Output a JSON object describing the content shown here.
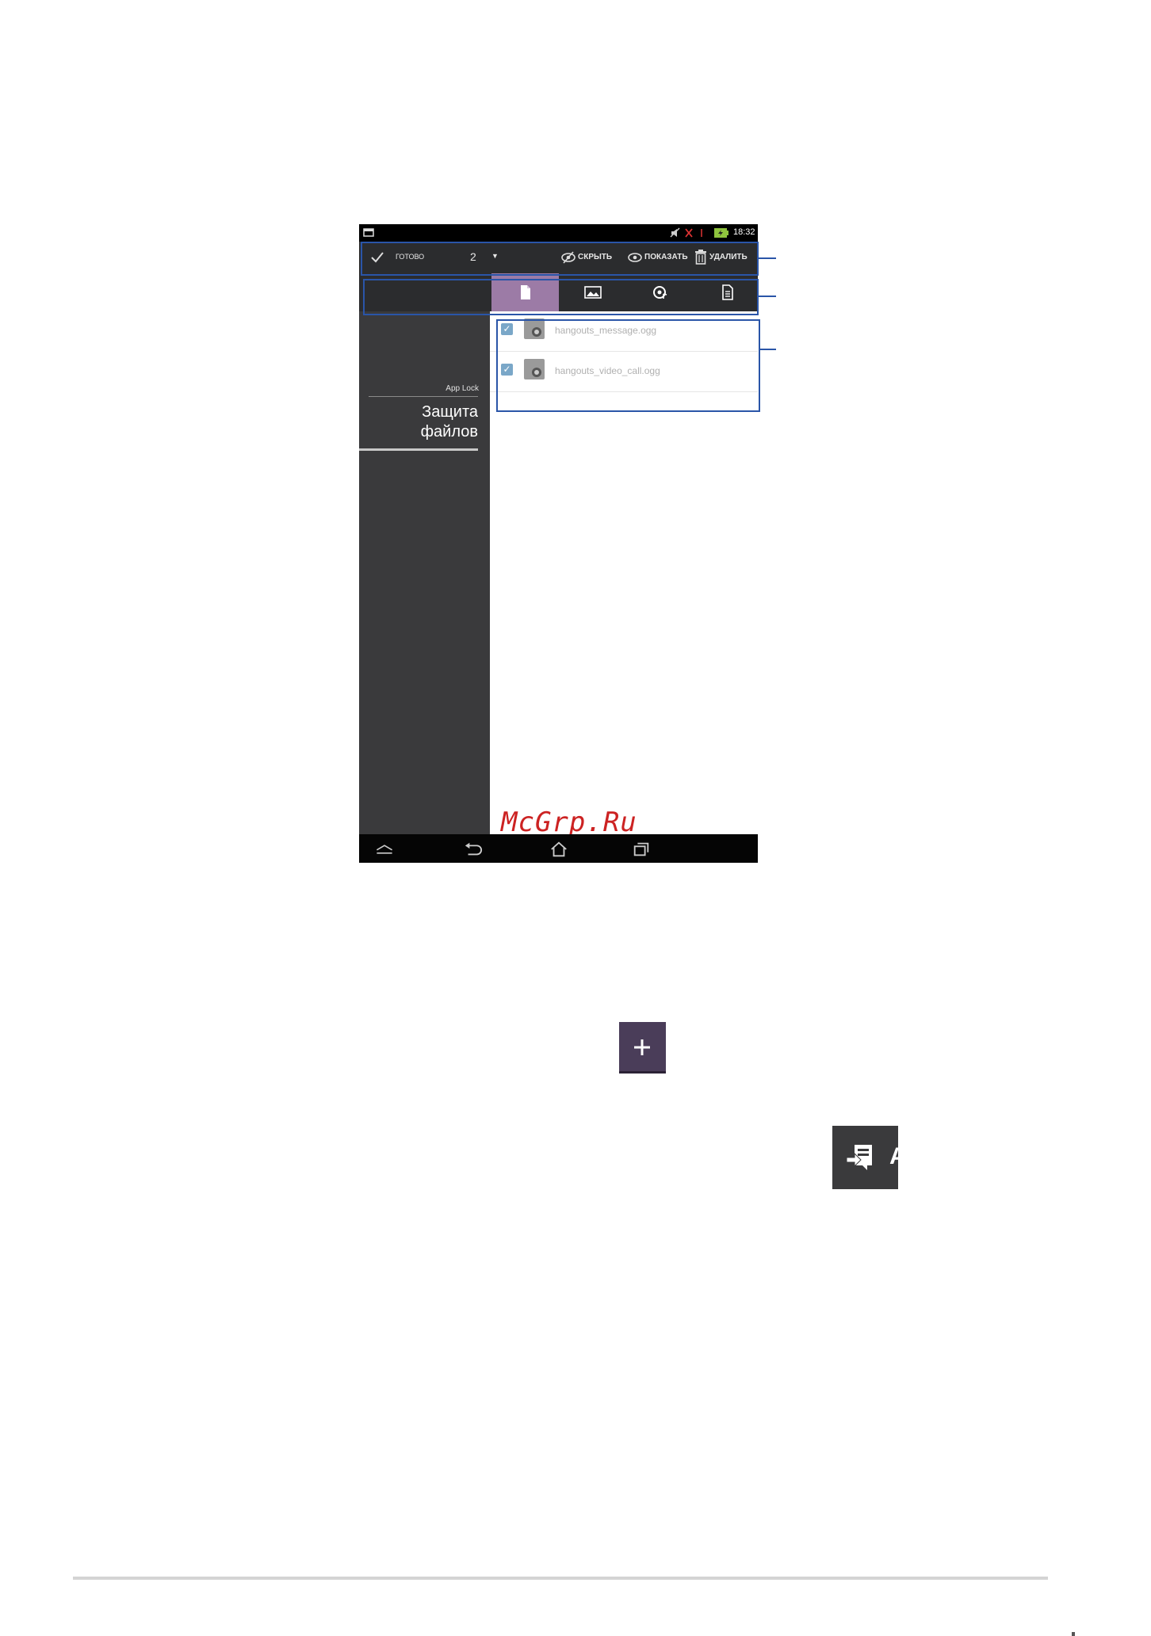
{
  "status_bar": {
    "time": "18:32"
  },
  "action_bar": {
    "done_label": "ГОТОВО",
    "count": "2",
    "hide_label": "СКРЫТЬ",
    "show_label": "ПОКАЗАТЬ",
    "delete_label": "УДАЛИТЬ"
  },
  "tabs": [
    {
      "icon": "file-icon",
      "active": true
    },
    {
      "icon": "image-icon",
      "active": false
    },
    {
      "icon": "music-icon",
      "active": false
    },
    {
      "icon": "document-icon",
      "active": false
    }
  ],
  "sidebar": {
    "app_name": "App Lock",
    "section_title_line1": "Защита",
    "section_title_line2": "файлов"
  },
  "files": [
    {
      "name": "hangouts_message.ogg",
      "checked": true
    },
    {
      "name": "hangouts_video_call.ogg",
      "checked": true
    }
  ],
  "watermark": "McGrp.Ru",
  "colors": {
    "tab_active": "#9c7ba6",
    "callout_blue": "#2a55a8",
    "plus_button": "#4a3d59",
    "arrow_button": "#3a3a3c"
  },
  "icons": {
    "add_button_icon": "plus-icon",
    "side_button_icon": "move-to-icon",
    "side_button_glyph": "A"
  }
}
